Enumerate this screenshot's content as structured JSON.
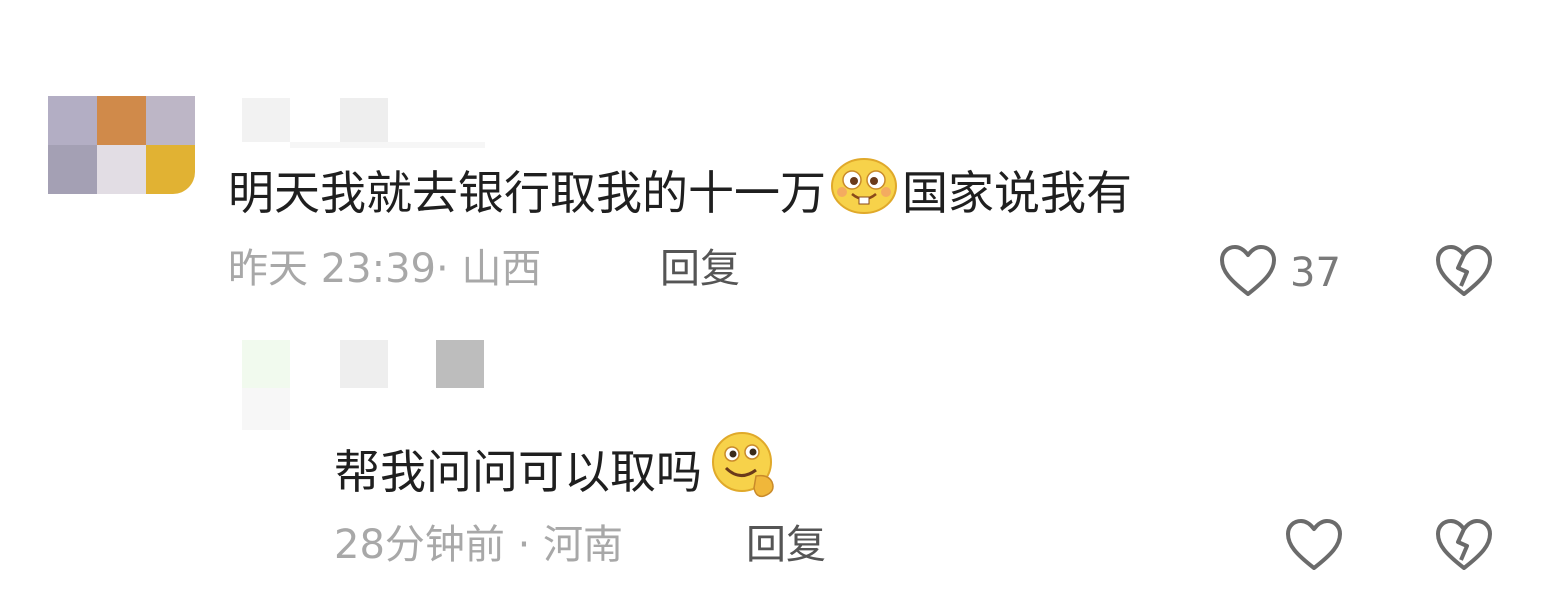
{
  "comment": {
    "text_before_emoji": "明天我就去银行取我的十一万",
    "emoji": "grin-emoji",
    "text_after_emoji": "国家说我有",
    "time": "昨天 23:39",
    "separator": "·",
    "location": "山西",
    "reply_label": "回复",
    "likes": "37"
  },
  "reply": {
    "text": "帮我问问可以取吗",
    "emoji": "thinking-smile-emoji",
    "time": "28分钟前",
    "separator": "·",
    "location": "河南",
    "reply_label": "回复"
  },
  "colors": {
    "text": "#1f1f1f",
    "meta": "#a8a8a8",
    "icon": "#6b6b6b",
    "emoji_yellow": "#f7d24a"
  }
}
